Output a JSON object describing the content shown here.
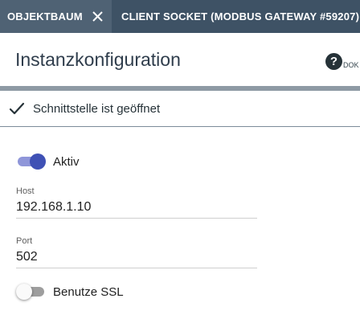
{
  "tabs": [
    {
      "label": "OBJEKTBAUM"
    },
    {
      "label": "CLIENT SOCKET (MODBUS GATEWAY #59207)"
    }
  ],
  "header": {
    "title": "Instanzkonfiguration",
    "help_icon_glyph": "?",
    "help_label": "DOK"
  },
  "status": {
    "text": "Schnittstelle ist geöffnet",
    "icon": "check-icon"
  },
  "form": {
    "aktiv": {
      "label": "Aktiv",
      "checked": true
    },
    "host": {
      "label": "Host",
      "value": "192.168.1.10"
    },
    "port": {
      "label": "Port",
      "value": "502"
    },
    "ssl": {
      "label": "Benutze SSL",
      "checked": false
    }
  },
  "colors": {
    "tab_bar": "#4f6274",
    "tab_active": "#3e5265",
    "title": "#2f3d4c",
    "toggle_on": "#3f51b5",
    "separator": "#8e9aa4"
  }
}
